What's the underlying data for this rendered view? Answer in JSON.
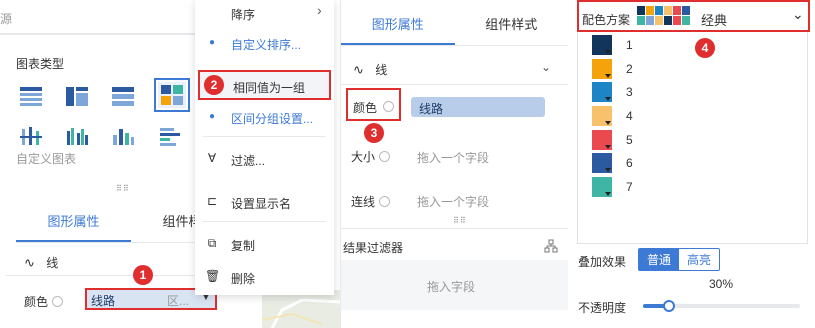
{
  "panel1": {
    "top_text": "源",
    "chart_type_title": "图表类型",
    "custom_chart_label": "自定义图表",
    "tabs": [
      {
        "label": "图形属性"
      },
      {
        "label": "组件样式"
      }
    ],
    "shape_label": "线",
    "color_label": "颜色",
    "color_field": "线路",
    "color_field_suffix": "区...",
    "badge": "1"
  },
  "context_menu": {
    "items": [
      {
        "label": "降序",
        "icon": "sort-icon"
      },
      {
        "label": "自定义排序...",
        "icon": "dot-icon"
      },
      {
        "label": "相同值为一组",
        "icon": "dot-icon"
      },
      {
        "label": "区间分组设置...",
        "icon": "dot-icon"
      },
      {
        "label": "过滤...",
        "icon": "filter-icon"
      },
      {
        "label": "设置显示名",
        "icon": "rename-icon"
      },
      {
        "label": "复制",
        "icon": "copy-icon"
      },
      {
        "label": "删除",
        "icon": "delete-icon"
      }
    ],
    "badge": "2"
  },
  "panel2": {
    "tabs": [
      {
        "label": "图形属性"
      },
      {
        "label": "组件样式"
      }
    ],
    "shape_label": "线",
    "color_label": "颜色",
    "color_field": "线路",
    "size_label": "大小",
    "size_placeholder": "拖入一个字段",
    "connect_label": "连线",
    "connect_placeholder": "拖入一个字段",
    "result_filter_label": "结果过滤器",
    "result_filter_placeholder": "拖入字段",
    "badge": "3"
  },
  "panel3": {
    "scheme_label": "配色方案",
    "scheme_value": "经典",
    "badge": "4",
    "swatches": [
      {
        "num": "1",
        "color": "#12355b"
      },
      {
        "num": "2",
        "color": "#f5a30a"
      },
      {
        "num": "3",
        "color": "#1d84c6"
      },
      {
        "num": "4",
        "color": "#f7c26b"
      },
      {
        "num": "5",
        "color": "#ea4a4f"
      },
      {
        "num": "6",
        "color": "#2b5aa0"
      },
      {
        "num": "7",
        "color": "#3fb5a6"
      }
    ],
    "overlay_label": "叠加效果",
    "overlay_options": [
      "普通",
      "高亮"
    ],
    "overlay_selected": "普通",
    "opacity_value": "30%",
    "opacity_label": "不透明度",
    "opacity_fraction": 0.3
  },
  "colors": {
    "accent": "#3d7ad6",
    "highlight_red": "#e02d2d"
  }
}
